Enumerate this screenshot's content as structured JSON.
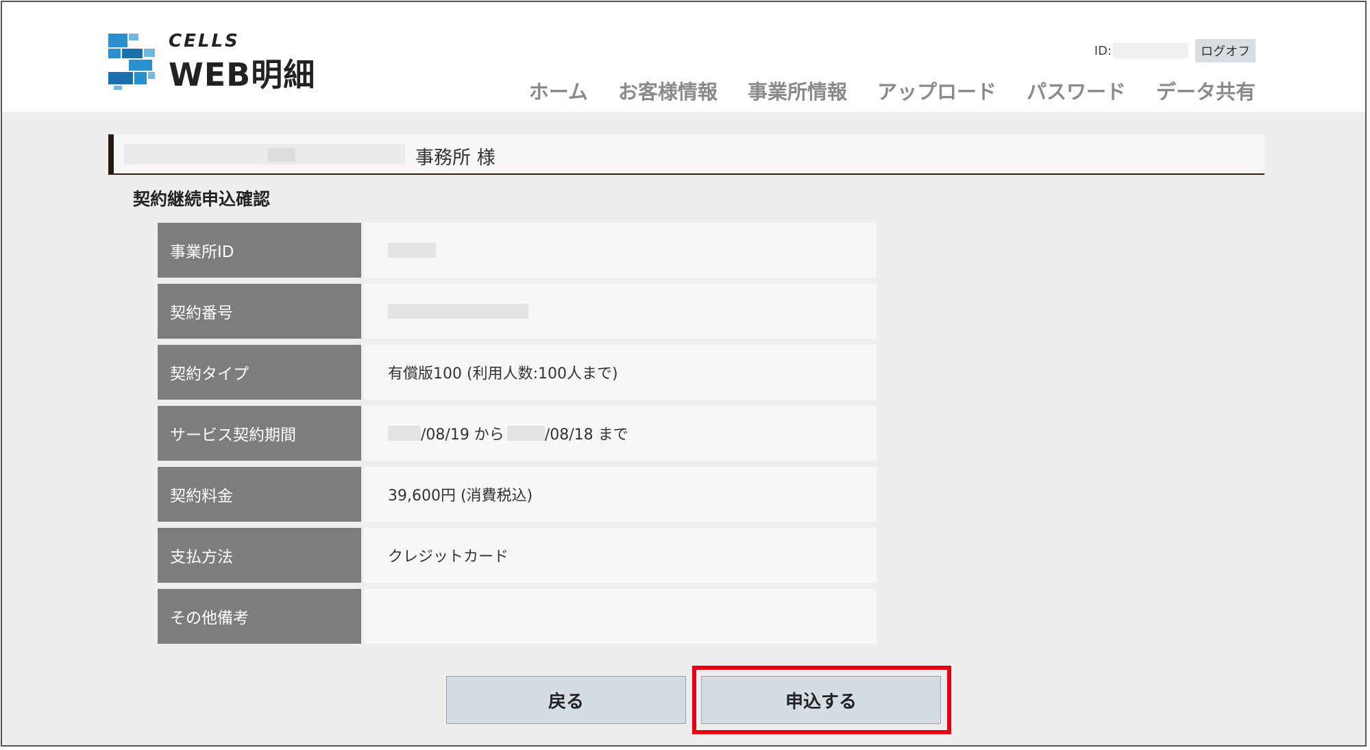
{
  "header": {
    "logo": {
      "top": "CELLS",
      "main": "WEB明細"
    },
    "account": {
      "id_label": "ID:",
      "logoff_label": "ログオフ"
    },
    "nav": [
      {
        "label": "ホーム"
      },
      {
        "label": "お客様情報"
      },
      {
        "label": "事業所情報"
      },
      {
        "label": "アップロード"
      },
      {
        "label": "パスワード"
      },
      {
        "label": "データ共有"
      }
    ]
  },
  "office": {
    "suffix": "事務所 様"
  },
  "section": {
    "title": "契約継続申込確認"
  },
  "table": {
    "rows": [
      {
        "label": "事業所ID",
        "value": ""
      },
      {
        "label": "契約番号",
        "value": ""
      },
      {
        "label": "契約タイプ",
        "value": "有償版100 (利用人数:100人まで)"
      },
      {
        "label": "サービス契約期間",
        "part1": "/08/19 から",
        "part2": "/08/18 まで"
      },
      {
        "label": "契約料金",
        "value": "39,600円 (消費税込)"
      },
      {
        "label": "支払方法",
        "value": "クレジットカード"
      },
      {
        "label": "その他備考",
        "value": ""
      }
    ]
  },
  "buttons": {
    "back_label": "戻る",
    "apply_label": "申込する"
  },
  "colors": {
    "highlight": "#e60012",
    "label_bg": "#7d7d7d",
    "nav_text": "#8a8a8a"
  }
}
